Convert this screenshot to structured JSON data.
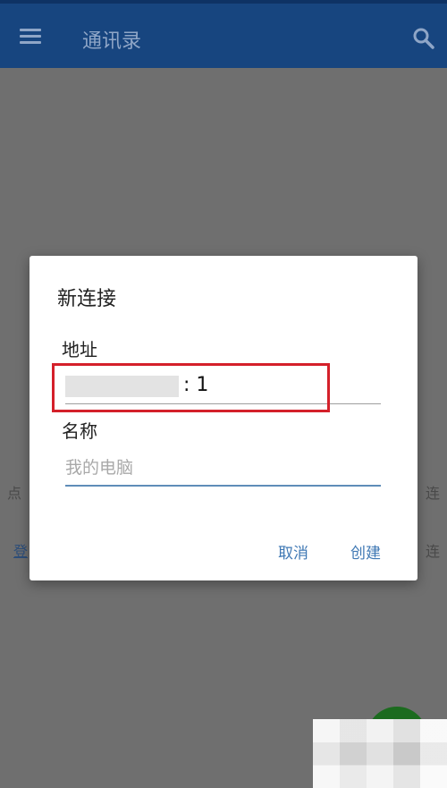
{
  "appbar": {
    "title": "通讯录",
    "menu_icon": "menu-icon",
    "search_icon": "search-icon",
    "color": "#17457f"
  },
  "background": {
    "left_text": "点",
    "right_text_1": "连",
    "left_link": "登",
    "right_text_2": "连"
  },
  "dialog": {
    "title": "新连接",
    "address_label": "地址",
    "address_value": ": 1",
    "name_label": "名称",
    "name_placeholder": "我的电脑",
    "cancel_label": "取消",
    "create_label": "创建",
    "highlight_color": "#d4202a",
    "accent_color": "#3f78b4"
  }
}
